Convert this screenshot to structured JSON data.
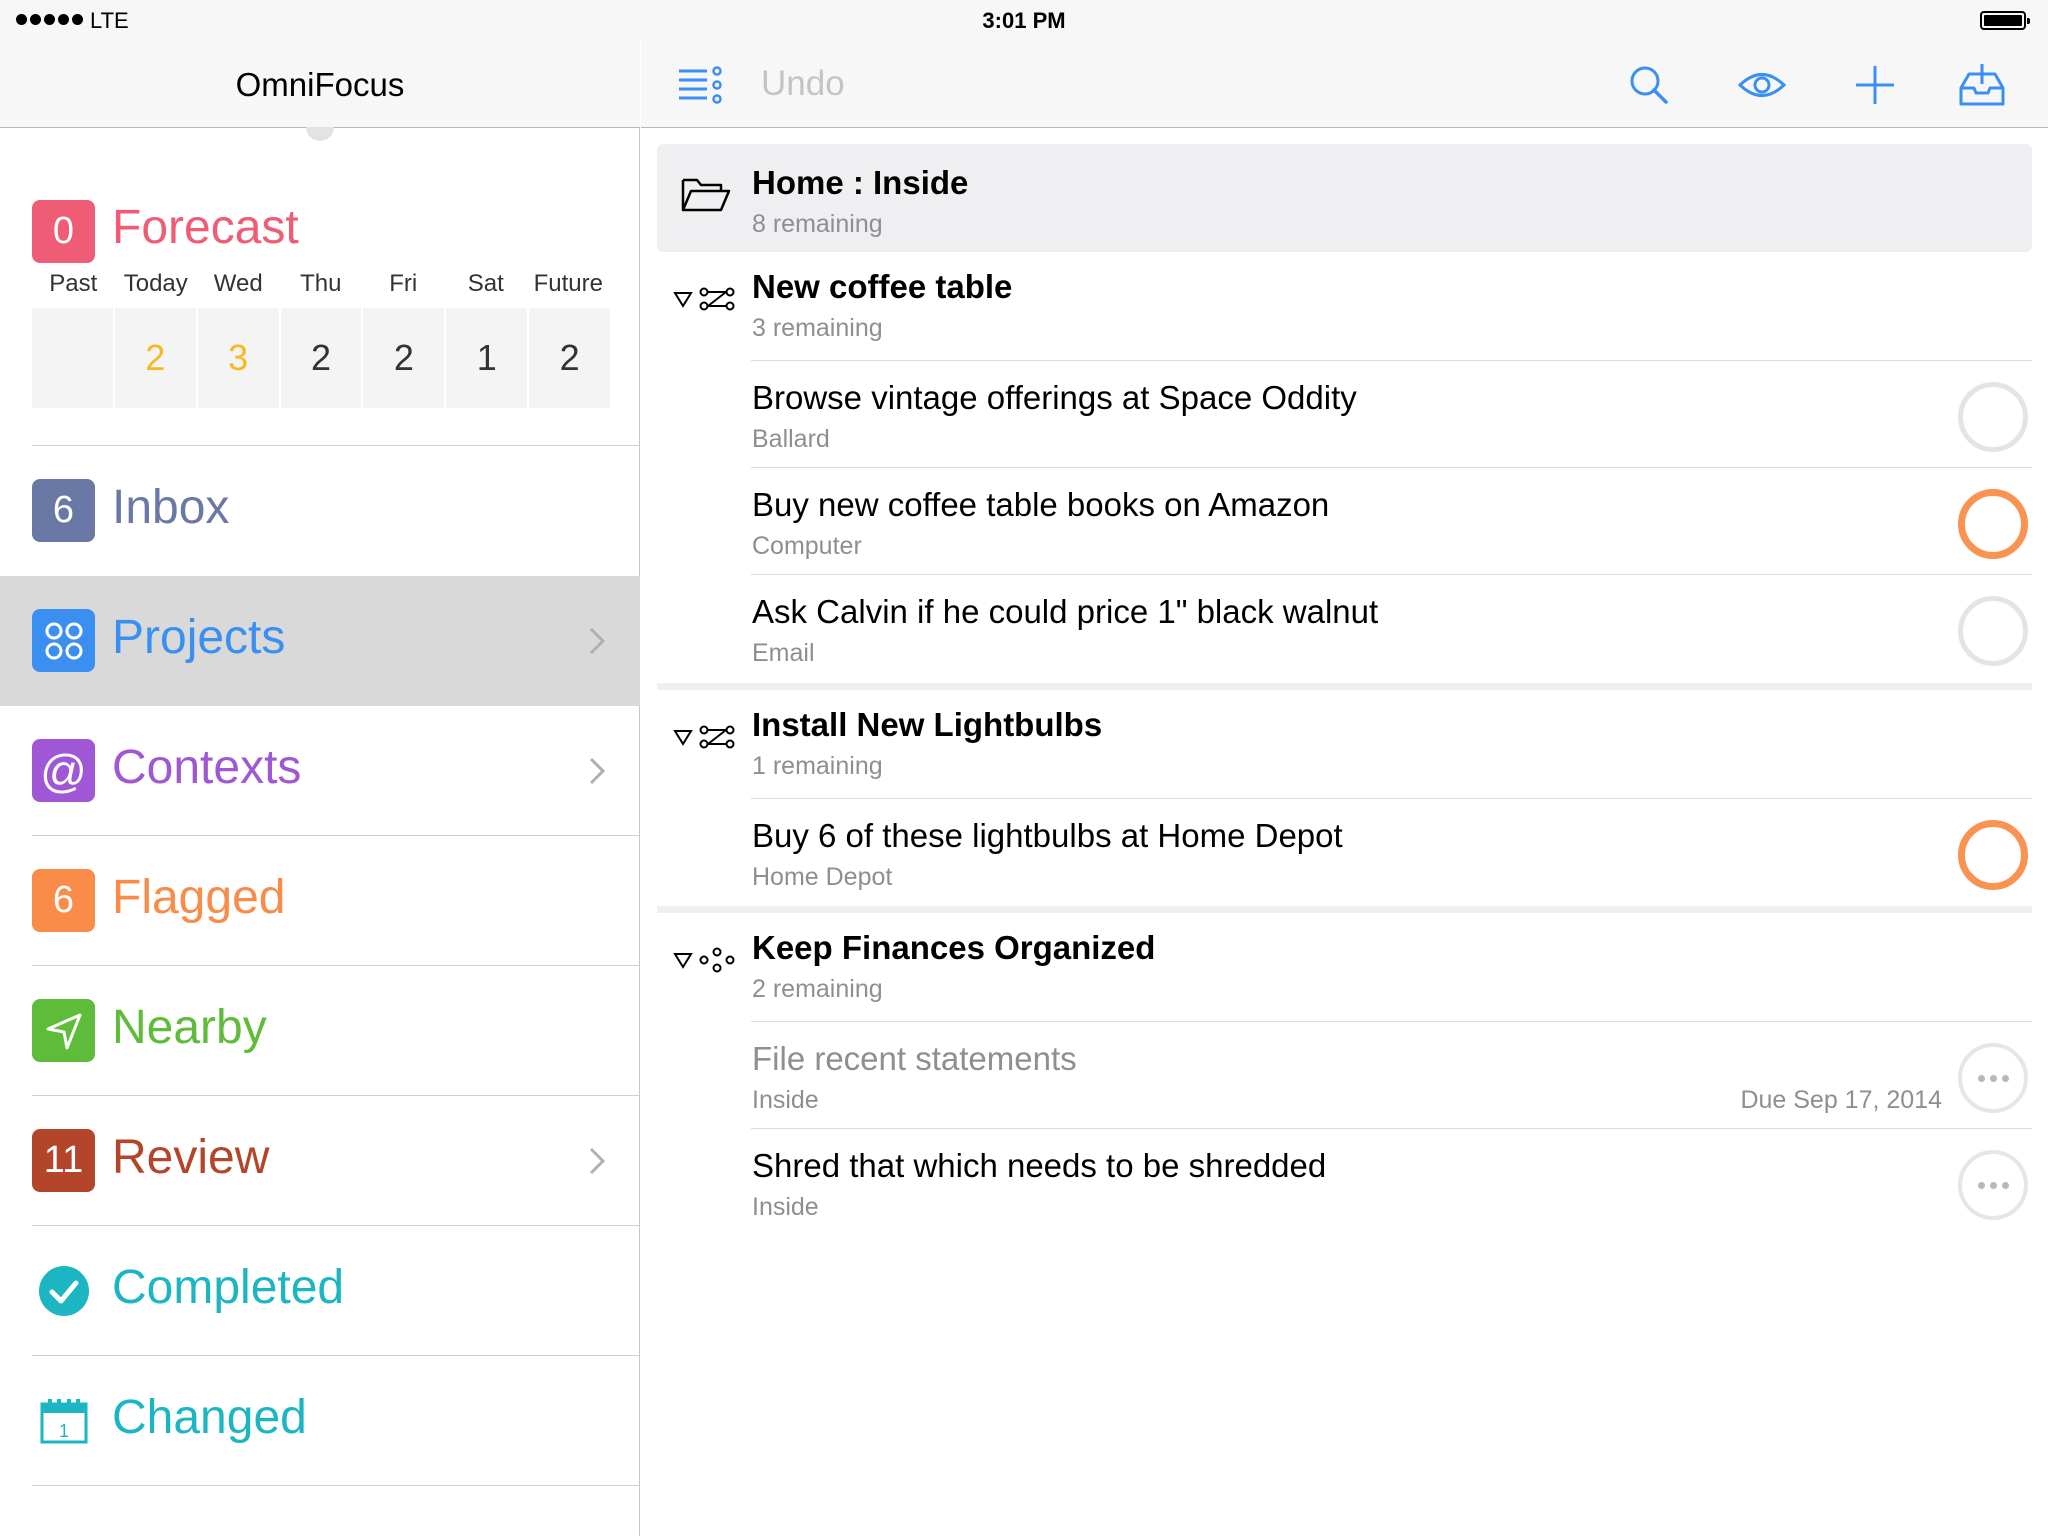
{
  "status_bar": {
    "carrier": "LTE",
    "time": "3:01 PM"
  },
  "sidebar": {
    "title": "OmniFocus",
    "forecast": {
      "badge": "0",
      "label": "Forecast",
      "days": [
        "Past",
        "Today",
        "Wed",
        "Thu",
        "Fri",
        "Sat",
        "Future"
      ],
      "counts": [
        "",
        "2",
        "3",
        "2",
        "2",
        "1",
        "2"
      ]
    },
    "items": [
      {
        "label": "Inbox",
        "badge": "6",
        "color": "#6a78a5"
      },
      {
        "label": "Projects",
        "badge": "",
        "color": "#3a8ff1"
      },
      {
        "label": "Contexts",
        "badge": "@",
        "color": "#a057d6"
      },
      {
        "label": "Flagged",
        "badge": "6",
        "color": "#f98c48"
      },
      {
        "label": "Nearby",
        "badge": "",
        "color": "#5fbc3a"
      },
      {
        "label": "Review",
        "badge": "11",
        "color": "#b3452a"
      },
      {
        "label": "Completed",
        "badge": "",
        "color": "#1cb5c2"
      },
      {
        "label": "Changed",
        "badge": "1",
        "color": "#1cb5c2"
      }
    ],
    "forecast_color": "#ef5c75"
  },
  "toolbar": {
    "undo_label": "Undo",
    "accent": "#3a8ff1"
  },
  "content": {
    "folder": {
      "title": "Home : Inside",
      "subtitle": "8 remaining"
    },
    "projects": [
      {
        "title": "New coffee table",
        "subtitle": "3 remaining",
        "tasks": [
          {
            "title": "Browse vintage offerings at Space Oddity",
            "context": "Ballard"
          },
          {
            "title": "Buy new coffee table books on Amazon",
            "context": "Computer"
          },
          {
            "title": "Ask Calvin if he could price 1\" black walnut",
            "context": "Email"
          }
        ]
      },
      {
        "title": "Install New Lightbulbs",
        "subtitle": "1 remaining",
        "tasks": [
          {
            "title": "Buy 6 of these lightbulbs at Home Depot",
            "context": "Home Depot"
          }
        ]
      },
      {
        "title": "Keep Finances Organized",
        "subtitle": "2 remaining",
        "tasks": [
          {
            "title": "File recent statements",
            "context": "Inside",
            "due": "Due Sep 17, 2014"
          },
          {
            "title": "Shred that which needs to be shredded",
            "context": "Inside"
          }
        ]
      }
    ]
  }
}
